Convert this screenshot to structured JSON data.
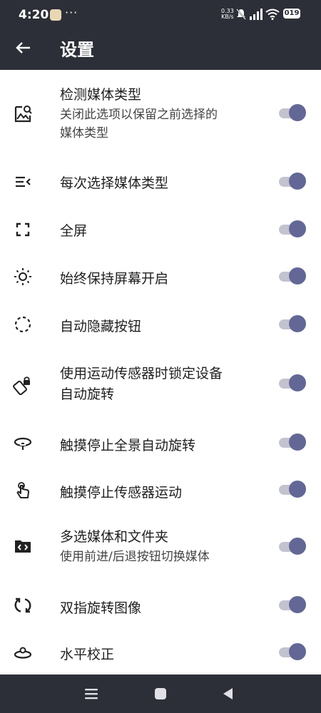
{
  "status_bar": {
    "time": "4:20",
    "more": "···",
    "net_speed_value": "0.33",
    "net_speed_unit": "KB/s",
    "battery": "019"
  },
  "appbar": {
    "title": "设置"
  },
  "settings": [
    {
      "title": "检测媒体类型",
      "subtitle_line1": "关闭此选项以保留之前选择的",
      "subtitle_line2": "媒体类型",
      "enabled": true
    },
    {
      "title": "每次选择媒体类型",
      "enabled": true
    },
    {
      "title": "全屏",
      "enabled": true
    },
    {
      "title": "始终保持屏幕开启",
      "enabled": true
    },
    {
      "title": "自动隐藏按钮",
      "enabled": true
    },
    {
      "title_line1": "使用运动传感器时锁定设备",
      "title_line2": "自动旋转",
      "enabled": true
    },
    {
      "title": "触摸停止全景自动旋转",
      "enabled": true
    },
    {
      "title": "触摸停止传感器运动",
      "enabled": true
    },
    {
      "title": "多选媒体和文件夹",
      "subtitle": "使用前进/后退按钮切换媒体",
      "enabled": true
    },
    {
      "title": "双指旋转图像",
      "enabled": true
    },
    {
      "title": "水平校正",
      "enabled": true
    }
  ],
  "colors": {
    "topbar": "#2d2f38",
    "toggle_thumb": "#636796",
    "toggle_track": "#c2c3cf"
  }
}
